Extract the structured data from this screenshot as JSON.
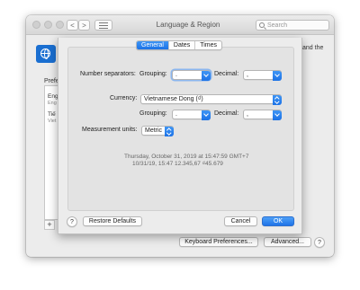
{
  "window": {
    "title": "Language & Region",
    "search_placeholder": "Search",
    "nav_back": "<",
    "nav_forward": ">",
    "background_text_right": "and the",
    "preferred_label": "Prefe",
    "list_items": [
      {
        "label": "Eng",
        "sub": "Eng"
      },
      {
        "label": "Tiế",
        "sub": "Viet"
      }
    ],
    "add_button": "+",
    "keyboard_prefs_button": "Keyboard Preferences...",
    "advanced_button": "Advanced...",
    "help_button": "?"
  },
  "sheet": {
    "tabs": [
      {
        "label": "General",
        "selected": true
      },
      {
        "label": "Dates",
        "selected": false
      },
      {
        "label": "Times",
        "selected": false
      }
    ],
    "number_separators_label": "Number separators:",
    "grouping_label": "Grouping:",
    "grouping_value": ".",
    "decimal_label": "Decimal:",
    "decimal_value": ",",
    "currency_label": "Currency:",
    "currency_value": "Vietnamese Dong (₫)",
    "currency_grouping_label": "Grouping:",
    "currency_grouping_value": ".",
    "currency_decimal_label": "Decimal:",
    "currency_decimal_value": ",",
    "measurement_label": "Measurement units:",
    "measurement_value": "Metric",
    "sample_date": "Thursday, October 31, 2019 at 15:47:59 GMT+7",
    "sample_line2": "10/31/19, 15:47     12.345,67     ₫45.679",
    "help_button": "?",
    "restore_button": "Restore Defaults",
    "cancel_button": "Cancel",
    "ok_button": "OK"
  },
  "colors": {
    "accent": "#1c72e6",
    "window_bg": "#ececec"
  }
}
